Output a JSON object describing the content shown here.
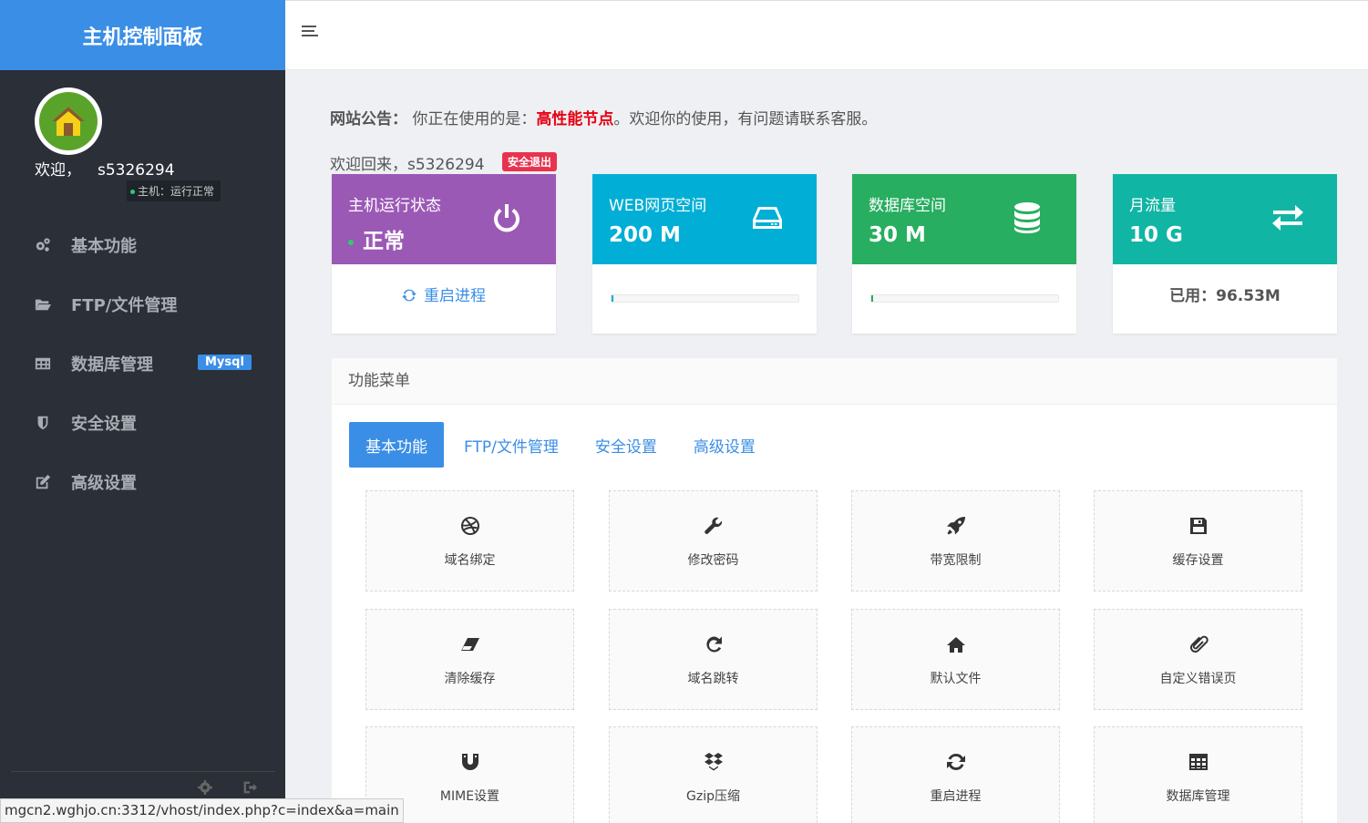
{
  "sidebar": {
    "brand": "主机控制面板",
    "welcome_label": "欢迎，",
    "username": "s5326294",
    "host_status": "主机：运行正常",
    "items": [
      {
        "label": "基本功能",
        "icon": "gears-icon"
      },
      {
        "label": "FTP/文件管理",
        "icon": "folder-icon"
      },
      {
        "label": "数据库管理",
        "icon": "table-icon",
        "badge": "Mysql"
      },
      {
        "label": "安全设置",
        "icon": "shield-icon"
      },
      {
        "label": "高级设置",
        "icon": "edit-icon"
      }
    ]
  },
  "notice": {
    "label": "网站公告：",
    "prefix": "你正在使用的是：",
    "highlight": "高性能节点",
    "suffix": "。欢迎你的使用，有问题请联系客服。"
  },
  "greeting": {
    "text": "欢迎回来，s5326294",
    "logout": "安全退出"
  },
  "cards": {
    "status": {
      "title": "主机运行状态",
      "value": "正常",
      "link": "重启进程",
      "color": "#9b59b6"
    },
    "web": {
      "title": "WEB网页空间",
      "value": "200 M",
      "usage_fraction": 0.01,
      "color": "#00aed6"
    },
    "db": {
      "title": "数据库空间",
      "value": "30 M",
      "usage_fraction": 0.01,
      "color": "#27ae60"
    },
    "traffic": {
      "title": "月流量",
      "value": "10 G",
      "used": "已用：96.53M",
      "color": "#11b5a4"
    }
  },
  "panel": {
    "title": "功能菜单",
    "tabs": [
      "基本功能",
      "FTP/文件管理",
      "安全设置",
      "高级设置"
    ],
    "active_tab": 0,
    "tiles": [
      {
        "label": "域名绑定",
        "icon": "dribbble-icon"
      },
      {
        "label": "修改密码",
        "icon": "wrench-icon"
      },
      {
        "label": "带宽限制",
        "icon": "rocket-icon"
      },
      {
        "label": "缓存设置",
        "icon": "save-icon"
      },
      {
        "label": "清除缓存",
        "icon": "eraser-icon"
      },
      {
        "label": "域名跳转",
        "icon": "redo-icon"
      },
      {
        "label": "默认文件",
        "icon": "home-icon"
      },
      {
        "label": "自定义错误页",
        "icon": "paperclip-icon"
      },
      {
        "label": "MIME设置",
        "icon": "magnet-icon"
      },
      {
        "label": "Gzip压缩",
        "icon": "dropbox-icon"
      },
      {
        "label": "重启进程",
        "icon": "refresh-icon"
      },
      {
        "label": "数据库管理",
        "icon": "table-icon"
      }
    ]
  },
  "statusbar": {
    "url": "mgcn2.wghjo.cn:3312/vhost/index.php?c=index&a=main"
  }
}
